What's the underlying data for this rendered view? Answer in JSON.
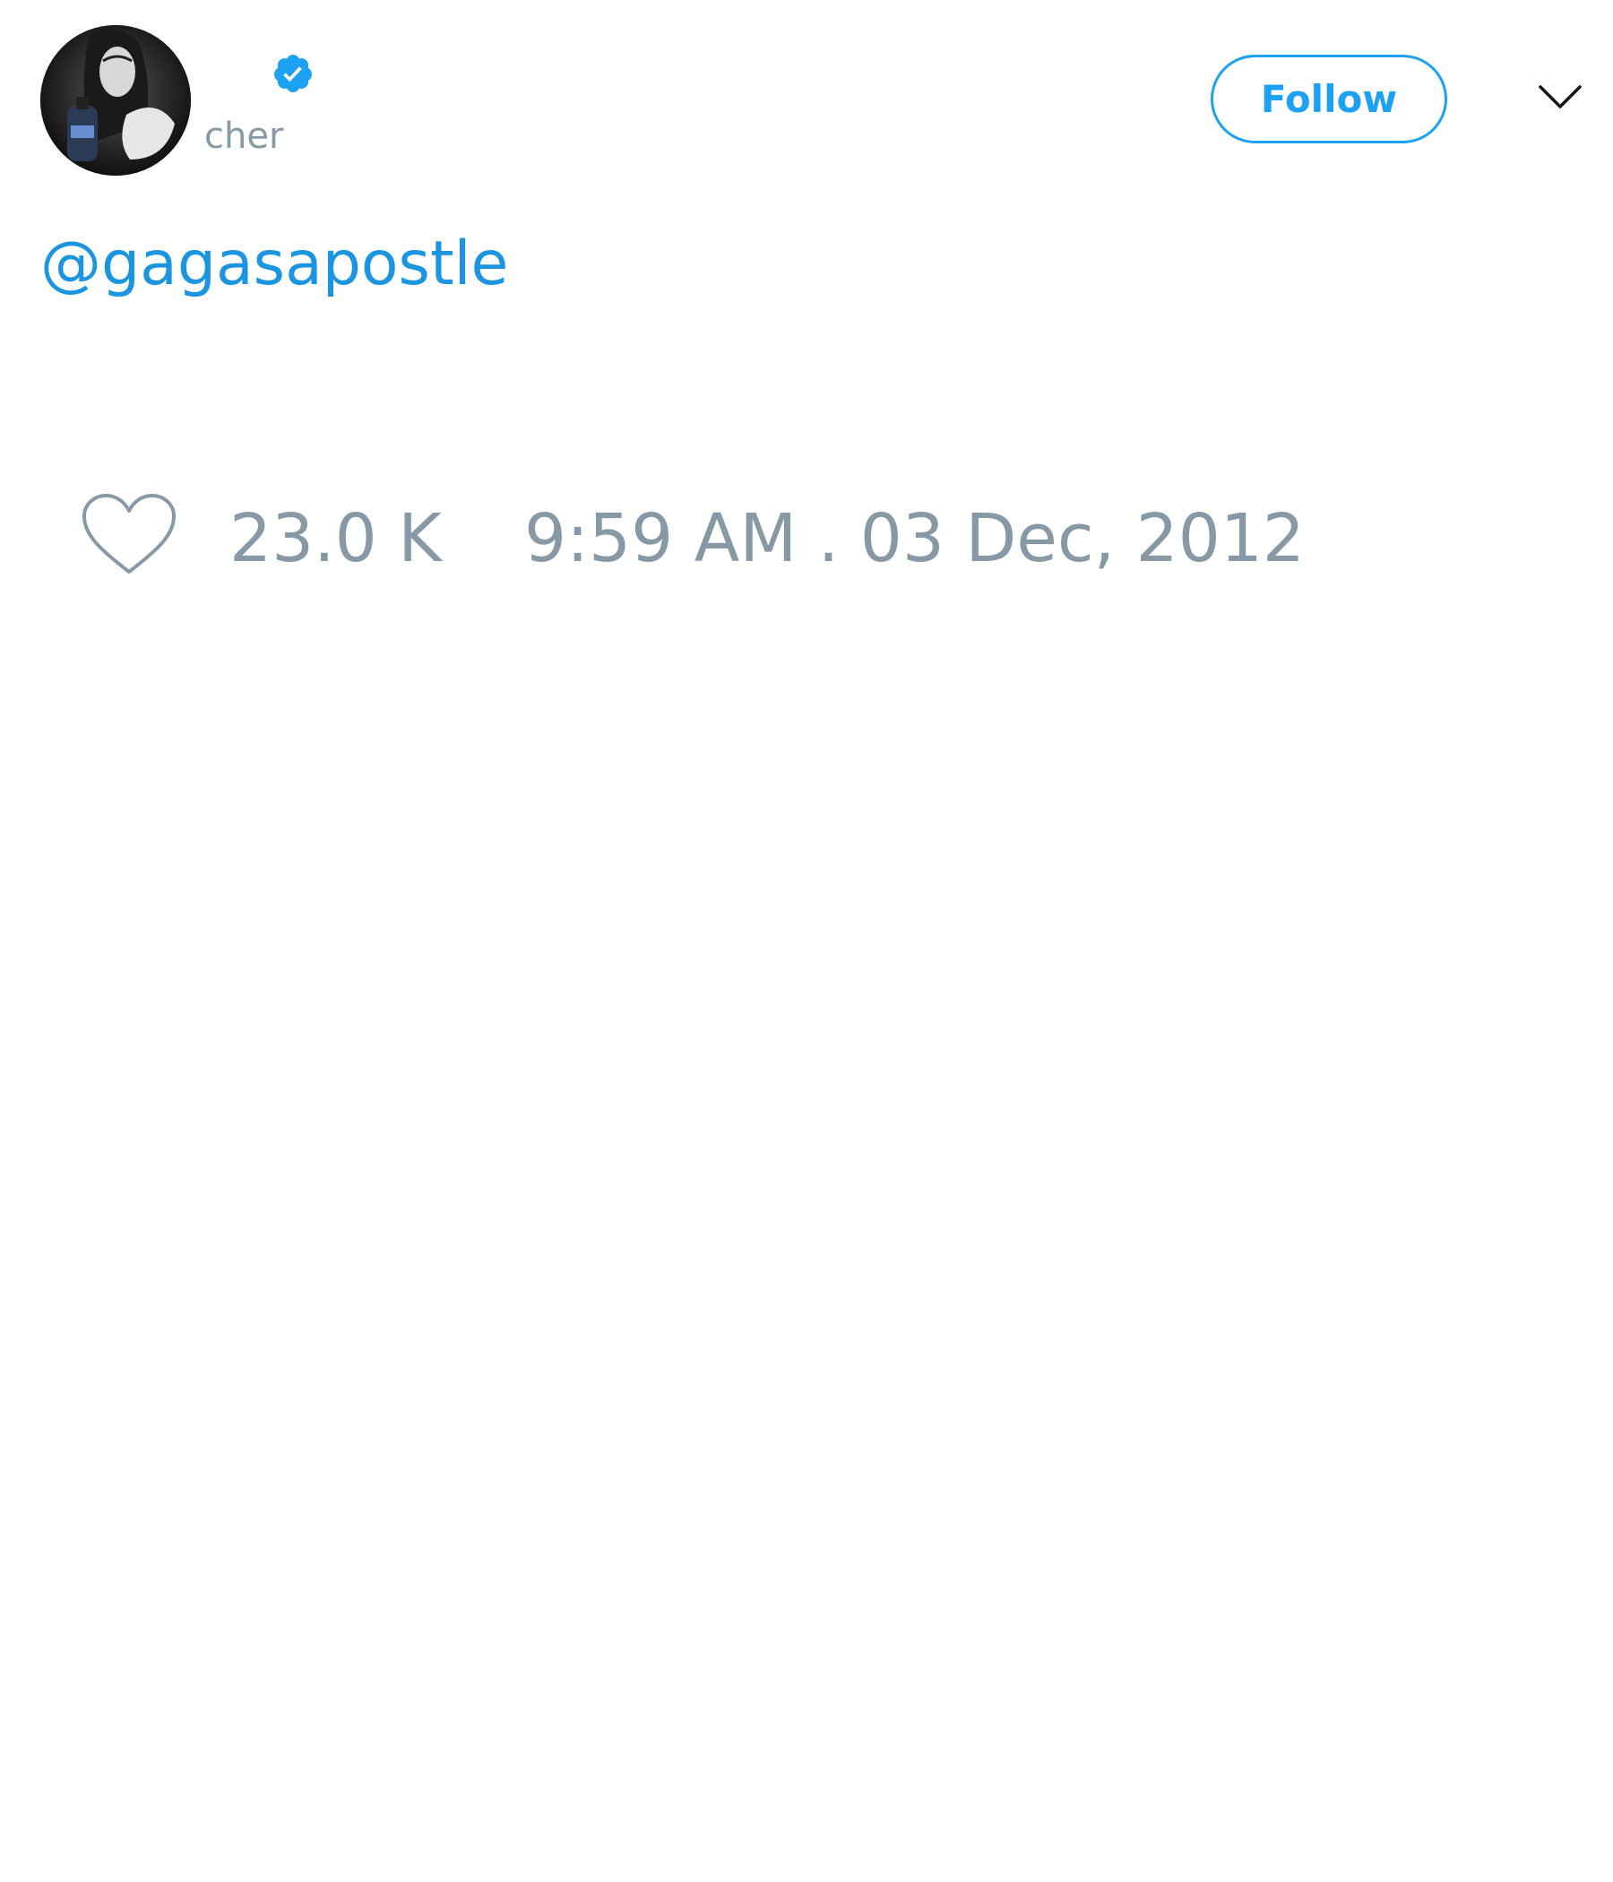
{
  "tweet": {
    "author": {
      "handle": "cher",
      "verified": true,
      "avatar_icon": "profile-photo"
    },
    "follow_label": "Follow",
    "text": "@gagasapostle",
    "likes": "23.0 K",
    "timestamp": "9:59 AM . 03 Dec, 2012"
  },
  "colors": {
    "accent": "#1da1f2",
    "link": "#1b95e0",
    "muted": "#8899a6"
  },
  "icons": {
    "verified": "verified-badge-icon",
    "menu": "chevron-down-icon",
    "like": "heart-icon"
  }
}
